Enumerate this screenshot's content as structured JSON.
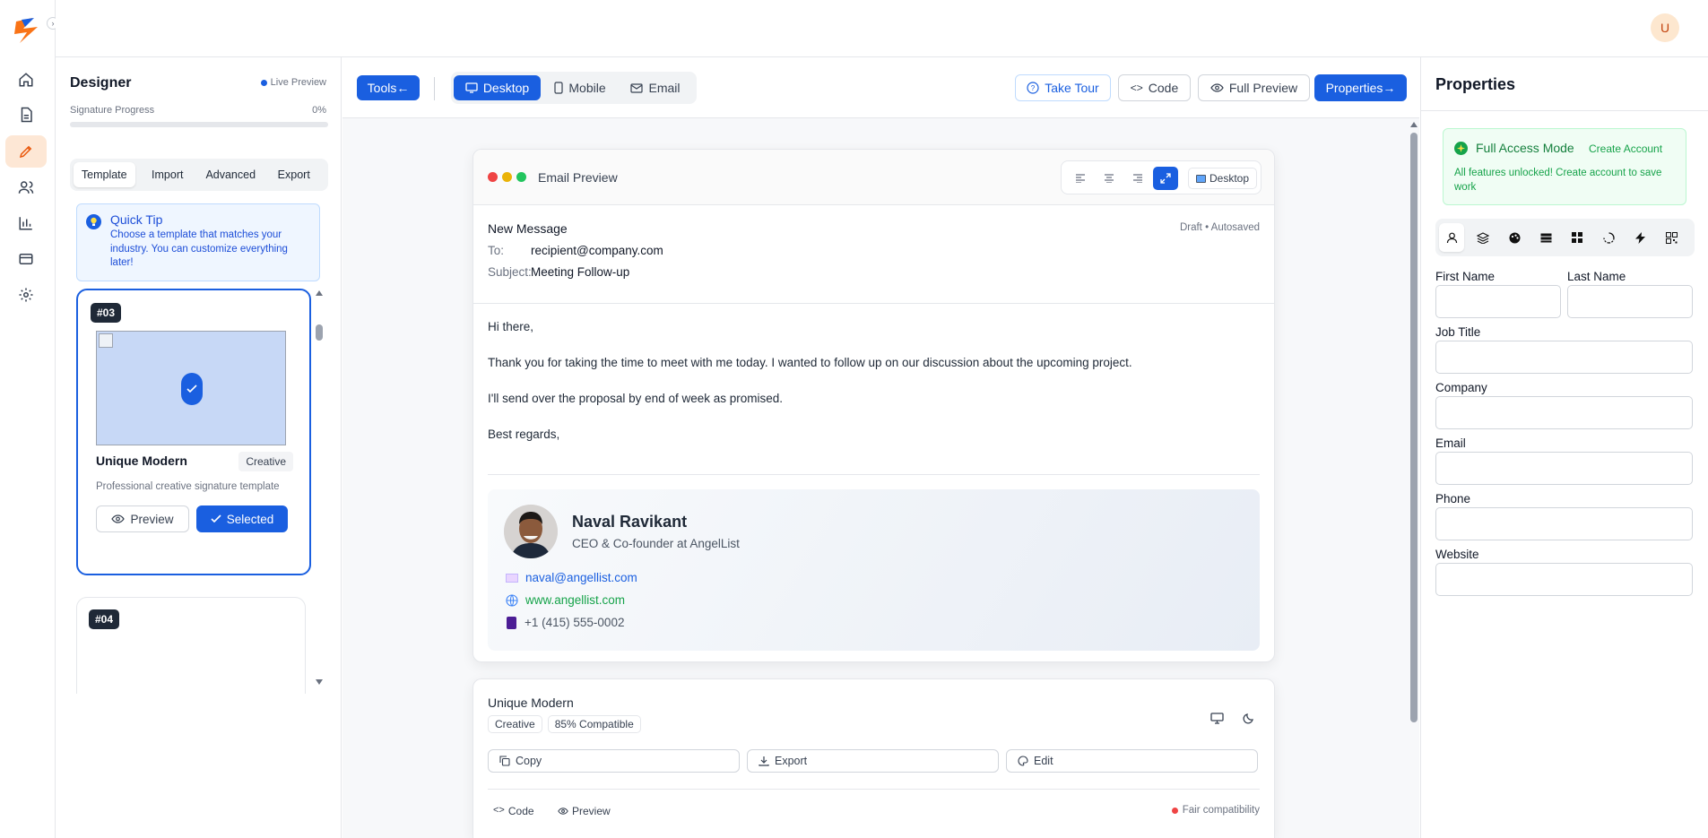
{
  "app": {
    "avatar_letter": "U"
  },
  "rail": {
    "items": [
      "home-icon",
      "document-icon",
      "pen-icon",
      "users-icon",
      "chart-icon",
      "card-icon",
      "gear-icon"
    ],
    "active": "pen-icon"
  },
  "designer": {
    "title": "Designer",
    "live_preview": "Live Preview",
    "progress_label": "Signature Progress",
    "progress_value": "0%",
    "tabs": [
      "Template",
      "Import",
      "Advanced",
      "Export"
    ],
    "active_tab": "Template",
    "tip": {
      "title": "Quick Tip",
      "text": "Choose a template that matches your industry. You can customize everything later!"
    },
    "templates": [
      {
        "number": "#03",
        "name": "Unique Modern",
        "tag": "Creative",
        "description": "Professional creative signature template",
        "preview_label": "Preview",
        "selected_label": "Selected"
      },
      {
        "number": "#04"
      }
    ]
  },
  "toolbar": {
    "tools": "Tools←",
    "views": [
      "Desktop",
      "Mobile",
      "Email"
    ],
    "active_view": "Desktop",
    "take_tour": "Take Tour",
    "code": "Code",
    "full_preview": "Full Preview",
    "properties": "Properties→"
  },
  "email": {
    "window_title": "Email Preview",
    "device_label": "Desktop",
    "new_message": "New Message",
    "status": "Draft • Autosaved",
    "to_label": "To:",
    "to_value": "recipient@company.com",
    "subject_label": "Subject:",
    "subject_value": "Meeting Follow-up",
    "body": [
      "Hi there,",
      "Thank you for taking the time to meet with me today. I wanted to follow up on our discussion about the upcoming project.",
      "I'll send over the proposal by end of week as promised.",
      "Best regards,"
    ],
    "signature": {
      "name": "Naval Ravikant",
      "title": "CEO & Co-founder at AngelList",
      "email": "naval@angellist.com",
      "website": "www.angellist.com",
      "phone": "+1 (415) 555-0002"
    }
  },
  "summary": {
    "template_name": "Unique Modern",
    "tag": "Creative",
    "compat": "85% Compatible",
    "copy": "Copy",
    "export": "Export",
    "edit": "Edit",
    "code": "Code",
    "preview": "Preview",
    "compat_status": "Fair compatibility"
  },
  "properties": {
    "title": "Properties",
    "access_title": "Full Access Mode",
    "create_account": "Create Account",
    "access_text": "All features unlocked! Create account to save work",
    "icon_tabs": [
      "person-icon",
      "layers-icon",
      "palette-icon",
      "layout-icon",
      "grid-icon",
      "animation-icon",
      "bolt-icon",
      "qr-icon"
    ],
    "fields": {
      "first_name": "First Name",
      "last_name": "Last Name",
      "job_title": "Job Title",
      "company": "Company",
      "email": "Email",
      "phone": "Phone",
      "website": "Website"
    }
  },
  "colors": {
    "primary": "#1a5fe0",
    "brand_orange": "#f97316",
    "success": "#16a34a",
    "danger": "#ef4444"
  }
}
